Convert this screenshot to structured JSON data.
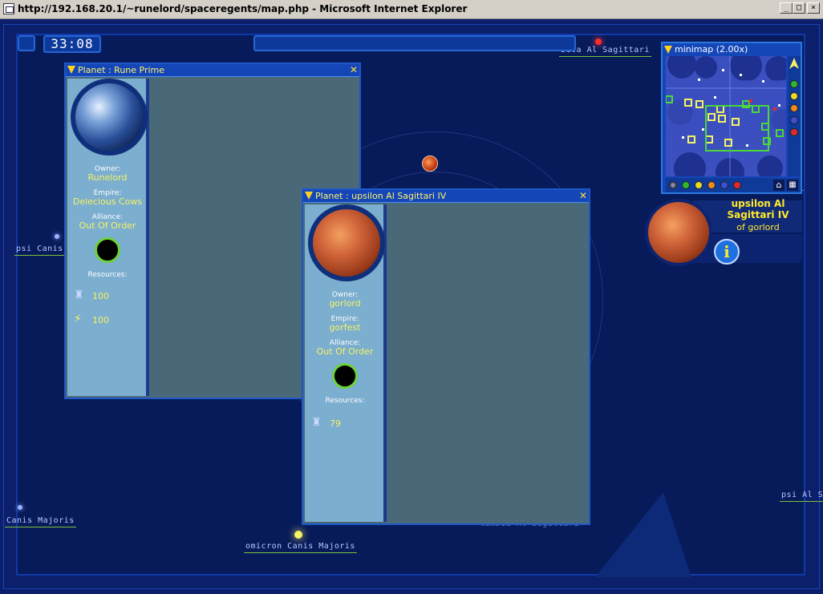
{
  "browser": {
    "title": "http://192.168.20.1/~runelord/spaceregents/map.php - Microsoft Internet Explorer",
    "minimize": "_",
    "maximize": "□",
    "close": "×"
  },
  "hud": {
    "clock": "33:08"
  },
  "stars": [
    {
      "label": "beta Al Sagittari"
    },
    {
      "label": "psi Canis M"
    },
    {
      "label": "Canis Majoris"
    },
    {
      "label": "omicron Canis Majoris"
    },
    {
      "label": "psi Al S"
    },
    {
      "label": "Al"
    },
    {
      "label": "lambda Al Sagittari"
    }
  ],
  "window_rune": {
    "title": "Planet : Rune Prime",
    "close": "✕",
    "owner_label": "Owner:",
    "owner": "Runelord",
    "empire_label": "Empire:",
    "empire": "Delecious Cows",
    "alliance_label": "Alliance:",
    "alliance": "Out Of Order",
    "resources_label": "Resources:",
    "resources": [
      {
        "icon": "crystal-icon",
        "value": "100"
      },
      {
        "icon": "energy-icon",
        "value": "100"
      }
    ]
  },
  "window_upsilon": {
    "title": "Planet : upsilon Al Sagittari IV",
    "close": "✕",
    "owner_label": "Owner:",
    "owner": "gorlord",
    "empire_label": "Empire:",
    "empire": "gorfest",
    "alliance_label": "Alliance:",
    "alliance": "Out Of Order",
    "resources_label": "Resources:",
    "resources": [
      {
        "icon": "crystal-icon",
        "value": "79"
      }
    ]
  },
  "minimap": {
    "title": "minimap (2.00x)",
    "filter_colors": [
      "#2fb82f",
      "#e8d82a",
      "#ef8a1a",
      "#3a4fd8",
      "#e02a2a"
    ]
  },
  "info_panel": {
    "planet": "upsilon Al Sagittari IV",
    "owner": "of gorlord",
    "info_button": "i"
  }
}
